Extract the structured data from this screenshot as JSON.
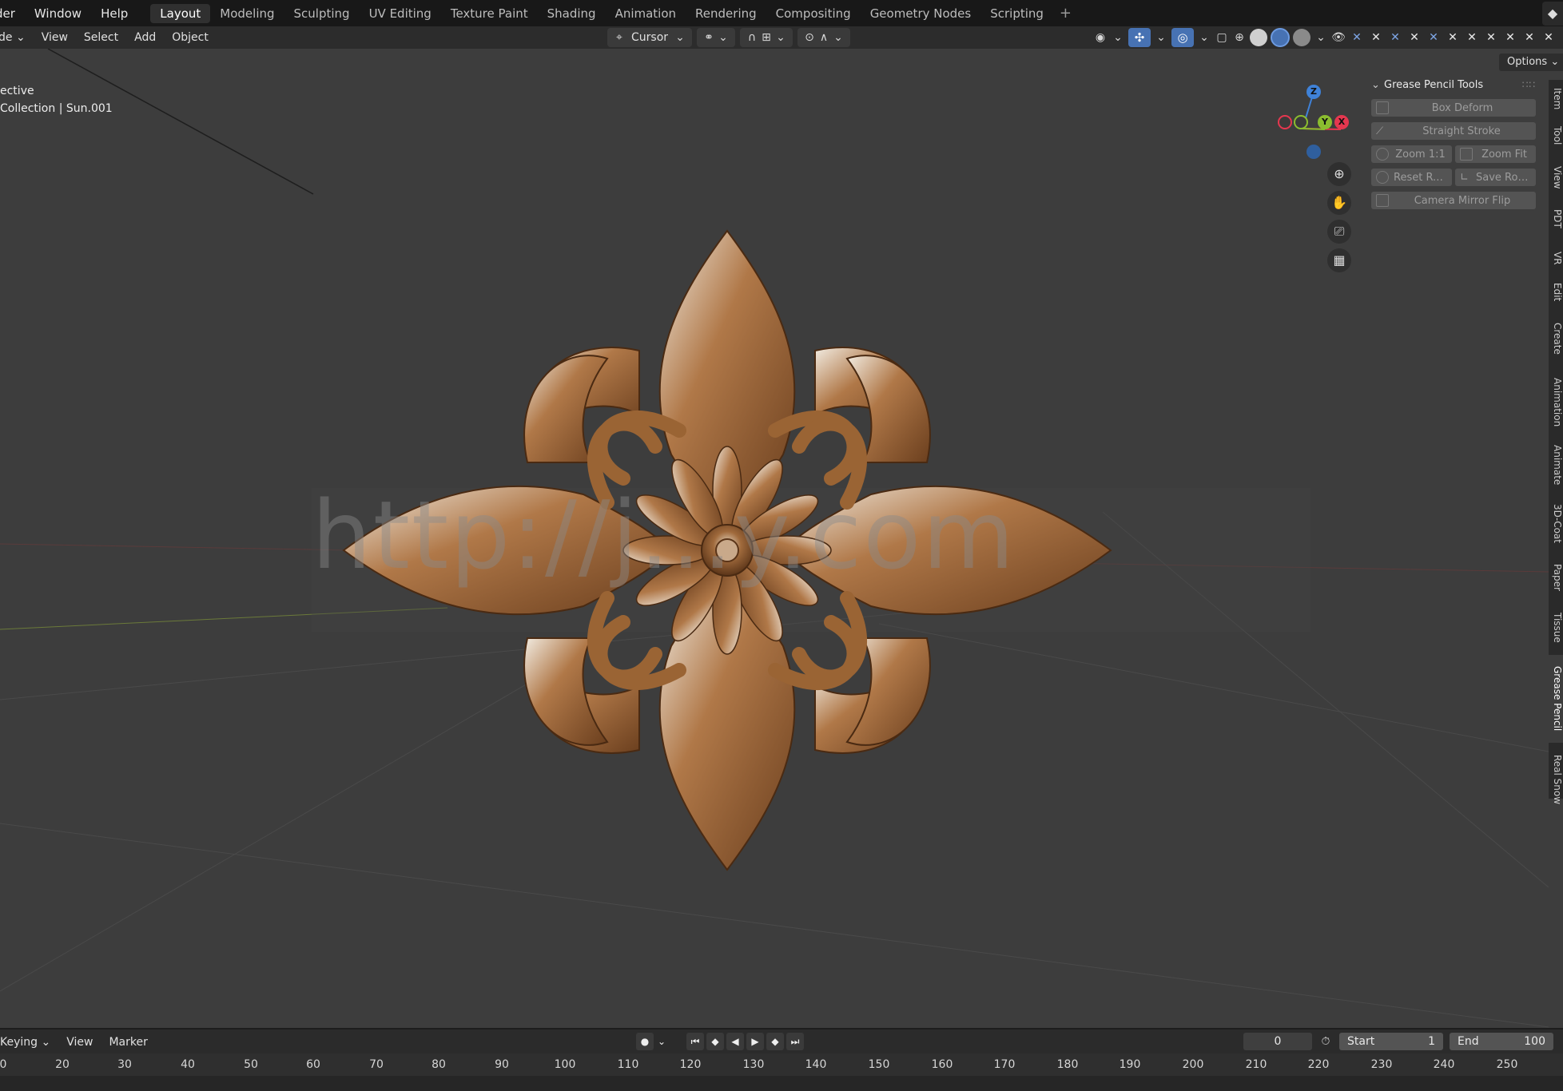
{
  "topbar": {
    "menu": [
      "der",
      "Window",
      "Help"
    ],
    "workspaces": [
      "Layout",
      "Modeling",
      "Sculpting",
      "UV Editing",
      "Texture Paint",
      "Shading",
      "Animation",
      "Rendering",
      "Compositing",
      "Geometry Nodes",
      "Scripting"
    ],
    "active_workspace": "Layout",
    "add_symbol": "+"
  },
  "viewport_header": {
    "mode": "de",
    "menu": [
      "View",
      "Select",
      "Add",
      "Object"
    ],
    "pivot_label": "Cursor",
    "options_label": "Options"
  },
  "viewport": {
    "info_line1": "ective",
    "info_line2": "Collection | Sun.001",
    "watermark": "http://j...y.com"
  },
  "gizmo": {
    "z": "Z",
    "y": "Y",
    "x": "X"
  },
  "npanel": {
    "title": "Grease Pencil Tools",
    "buttons": {
      "box_deform": "Box Deform",
      "straight_stroke": "Straight Stroke",
      "zoom_11": "Zoom 1:1",
      "zoom_fit": "Zoom Fit",
      "reset_rot": "Reset Ro...",
      "save_rot": "Save Rot...",
      "camera_mirror_flip": "Camera Mirror Flip"
    }
  },
  "side_tabs": [
    "Item",
    "Tool",
    "View",
    "PDT",
    "VR",
    "Edit",
    "Create",
    "Animation",
    "Animate",
    "3D-Coat",
    "Paper",
    "Tissue",
    "Grease Pencil",
    "Real Snow"
  ],
  "active_side_tab": "Grease Pencil",
  "timeline": {
    "menu": [
      "Keying",
      "View",
      "Marker"
    ],
    "current_frame": "0",
    "start_label": "Start",
    "start_value": "1",
    "end_label": "End",
    "end_value": "100",
    "ruler": [
      "0",
      "20",
      "30",
      "40",
      "50",
      "60",
      "70",
      "80",
      "90",
      "100",
      "110",
      "120",
      "130",
      "140",
      "150",
      "160",
      "170",
      "180",
      "190",
      "200",
      "210",
      "220",
      "230",
      "240",
      "250"
    ]
  },
  "colors": {
    "axis_x": "#e5374f",
    "axis_y": "#8bbd2f",
    "axis_z": "#3f82d8",
    "active_button": "#4772b3"
  }
}
